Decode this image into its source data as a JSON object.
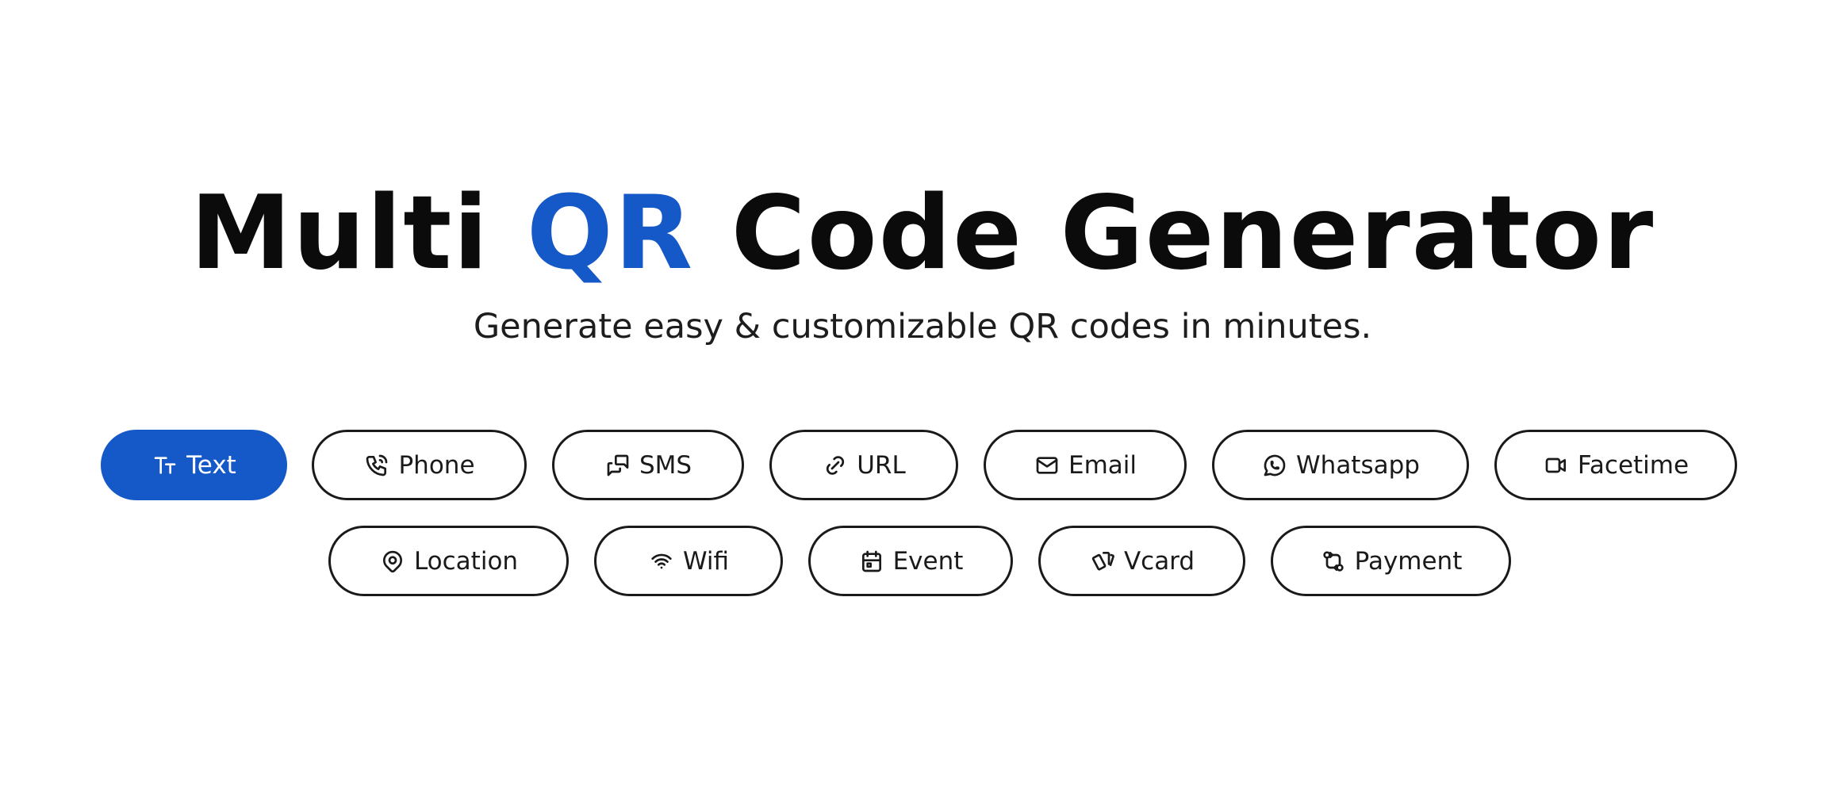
{
  "header": {
    "title_part1": "Multi ",
    "title_accent": "QR",
    "title_part2": " Code Generator",
    "subtitle": "Generate easy & customizable QR codes in minutes."
  },
  "types": [
    {
      "label": "Text",
      "icon": "text-type-icon",
      "active": true
    },
    {
      "label": "Phone",
      "icon": "phone-icon",
      "active": false
    },
    {
      "label": "SMS",
      "icon": "messages-icon",
      "active": false
    },
    {
      "label": "URL",
      "icon": "link-icon",
      "active": false
    },
    {
      "label": "Email",
      "icon": "mail-icon",
      "active": false
    },
    {
      "label": "Whatsapp",
      "icon": "whatsapp-icon",
      "active": false
    },
    {
      "label": "Facetime",
      "icon": "video-icon",
      "active": false
    },
    {
      "label": "Location",
      "icon": "map-pin-icon",
      "active": false
    },
    {
      "label": "Wifi",
      "icon": "wifi-icon",
      "active": false
    },
    {
      "label": "Event",
      "icon": "calendar-icon",
      "active": false
    },
    {
      "label": "Vcard",
      "icon": "cards-icon",
      "active": false
    },
    {
      "label": "Payment",
      "icon": "payment-flow-icon",
      "active": false
    }
  ],
  "colors": {
    "accent": "#1558c7",
    "text": "#111111",
    "border": "#1a1a1a",
    "background": "#ffffff"
  }
}
